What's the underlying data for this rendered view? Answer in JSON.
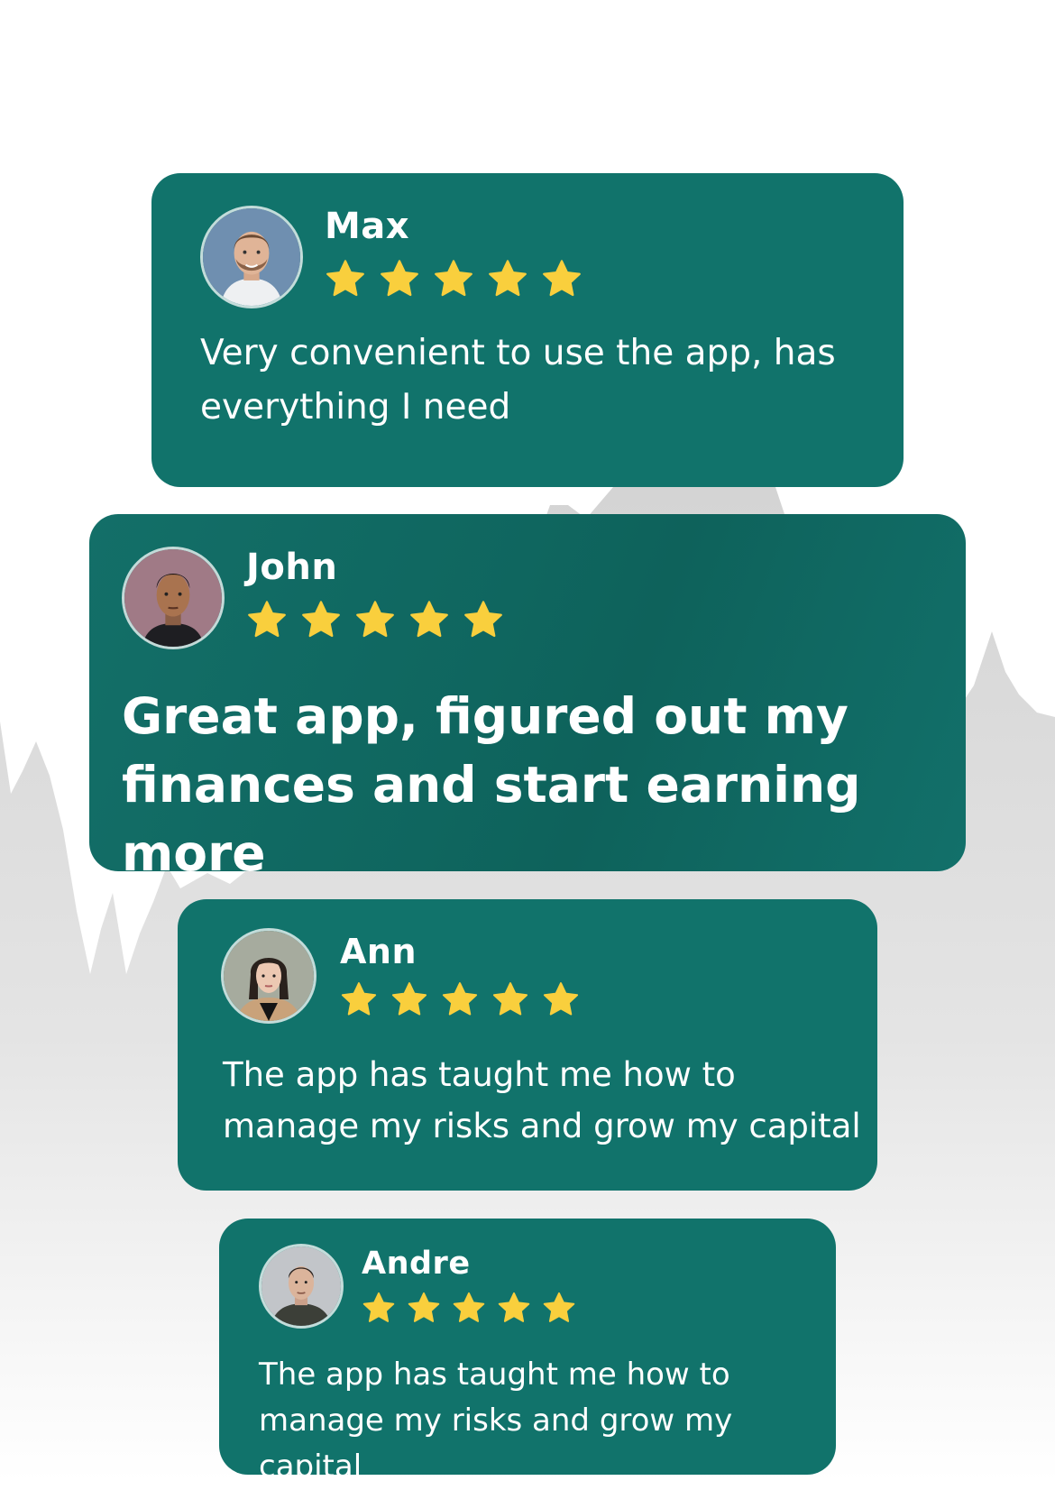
{
  "star_color": "#f9cf3d",
  "card_color": "#11736b",
  "reviews": [
    {
      "name": "Max",
      "rating": 5,
      "text": "Very convenient to use the app, has everything I need",
      "avatar": "max-avatar"
    },
    {
      "name": "John",
      "rating": 5,
      "text": "Great app, figured out my finances and start earning more",
      "avatar": "john-avatar"
    },
    {
      "name": "Ann",
      "rating": 5,
      "text": "The app has taught me how to manage  my risks and grow my capital",
      "avatar": "ann-avatar"
    },
    {
      "name": "Andre",
      "rating": 5,
      "text": "The app has taught me how to manage  my risks and grow my capital",
      "avatar": "andre-avatar"
    }
  ]
}
